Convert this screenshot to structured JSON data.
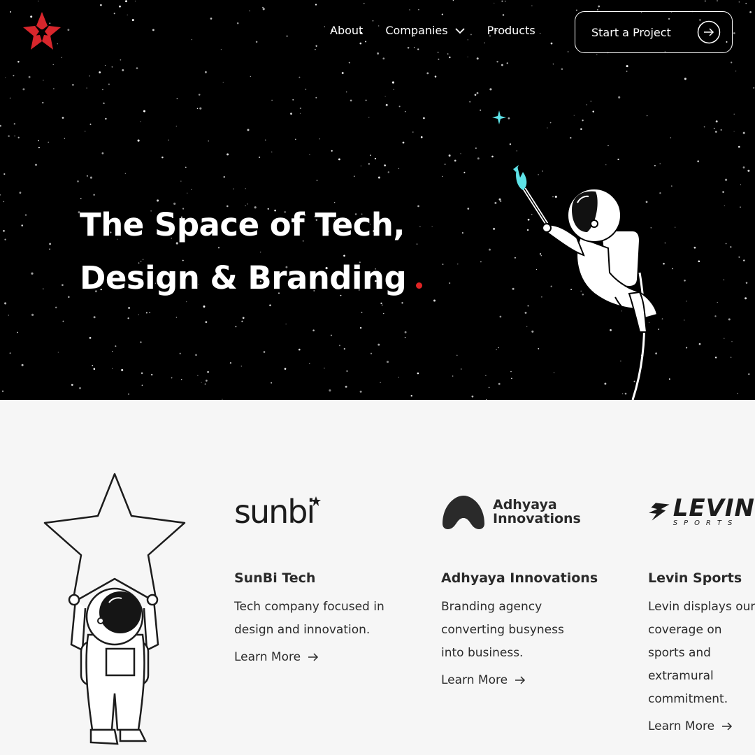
{
  "nav": {
    "about": "About",
    "companies": "Companies",
    "products": "Products",
    "cta": "Start a Project"
  },
  "hero": {
    "title_line1": "The Space of Tech,",
    "title_line2": "Design & Branding",
    "accent_color": "#e02424",
    "background": "#000000",
    "sparkle_color": "#5ee3e8"
  },
  "companies": [
    {
      "logo_text": "sunbi",
      "name": "SunBi Tech",
      "description": "Tech company focused in design and innovation.",
      "link": "Learn More"
    },
    {
      "logo_text_1": "Adhyaya",
      "logo_text_2": "Innovations",
      "name": "Adhyaya Innovations",
      "description": "Branding agency converting busyness into business.",
      "link": "Learn More"
    },
    {
      "logo_text": "LEVIN",
      "logo_sub": "SPORTS",
      "name": "Levin Sports",
      "description": "Levin displays our coverage on sports and extramural commitment.",
      "link": "Learn More"
    }
  ],
  "icons": [
    "logo-icon",
    "chevron-down-icon",
    "arrow-right-circle-icon",
    "arrow-right-icon",
    "astronaut-illustration",
    "star-illustration"
  ]
}
